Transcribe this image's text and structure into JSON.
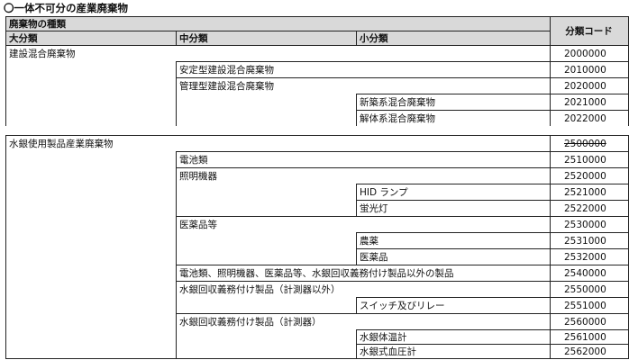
{
  "heading": "〇一体不可分の産業廃棄物",
  "header": {
    "type_group": "廃棄物の種類",
    "large": "大分類",
    "medium": "中分類",
    "small": "小分類",
    "code": "分類コード"
  },
  "rows": [
    {
      "large": "建設混合廃棄物",
      "medium": "",
      "small": "",
      "code": "2000000"
    },
    {
      "large": "",
      "medium": "安定型建設混合廃棄物",
      "small": "",
      "code": "2010000"
    },
    {
      "large": "",
      "medium": "管理型建設混合廃棄物",
      "small": "",
      "code": "2020000"
    },
    {
      "large": "",
      "medium": "",
      "small": "新築系混合廃棄物",
      "code": "2021000"
    },
    {
      "large": "",
      "medium": "",
      "small": "解体系混合廃棄物",
      "code": "2022000"
    },
    {
      "large": "水銀使用製品産業廃棄物",
      "medium": "",
      "small": "",
      "code": "2500000"
    },
    {
      "large": "",
      "medium": "電池類",
      "small": "",
      "code": "2510000"
    },
    {
      "large": "",
      "medium": "照明機器",
      "small": "",
      "code": "2520000"
    },
    {
      "large": "",
      "medium": "",
      "small": "HID ランプ",
      "code": "2521000"
    },
    {
      "large": "",
      "medium": "",
      "small": "蛍光灯",
      "code": "2522000"
    },
    {
      "large": "",
      "medium": "医薬品等",
      "small": "",
      "code": "2530000"
    },
    {
      "large": "",
      "medium": "",
      "small": "農薬",
      "code": "2531000"
    },
    {
      "large": "",
      "medium": "",
      "small": "医薬品",
      "code": "2532000"
    },
    {
      "large": "",
      "medium": "電池類、照明機器、医薬品等、水銀回収義務付け製品以外の製品",
      "small": "",
      "code": "2540000"
    },
    {
      "large": "",
      "medium": "水銀回収義務付け製品（計測器以外）",
      "small": "",
      "code": "2550000"
    },
    {
      "large": "",
      "medium": "",
      "small": "スイッチ及びリレー",
      "code": "2551000"
    },
    {
      "large": "",
      "medium": "水銀回収義務付け製品（計測器）",
      "small": "",
      "code": "2560000"
    },
    {
      "large": "",
      "medium": "",
      "small": "水銀体温計",
      "code": "2561000"
    },
    {
      "large": "",
      "medium": "",
      "small": "水銀式血圧計",
      "code": "2562000"
    }
  ]
}
